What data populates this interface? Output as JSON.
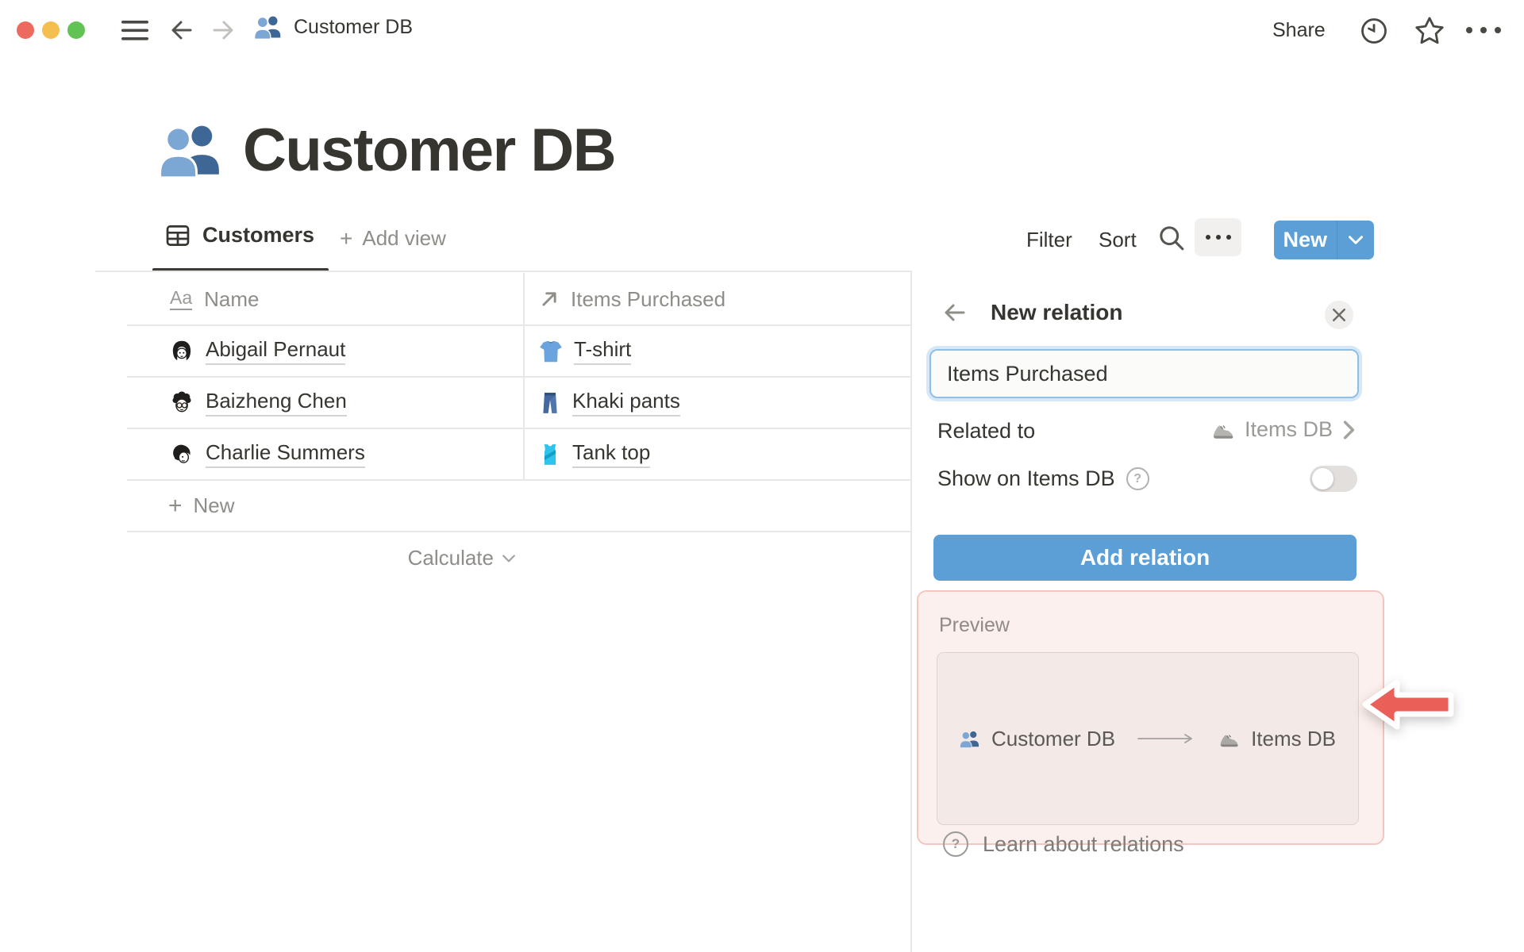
{
  "topbar": {
    "title": "Customer DB",
    "share_label": "Share"
  },
  "page": {
    "title": "Customer DB"
  },
  "toolbar": {
    "tab_label": "Customers",
    "add_plus": "+",
    "add_view_label": "Add view",
    "filter_label": "Filter",
    "sort_label": "Sort",
    "new_label": "New"
  },
  "table": {
    "name_type_icon": "Aa",
    "headers": {
      "name": "Name",
      "items": "Items Purchased"
    },
    "rows": [
      {
        "name": "Abigail Pernaut",
        "item": "T-shirt"
      },
      {
        "name": "Baizheng Chen",
        "item": "Khaki pants"
      },
      {
        "name": "Charlie Summers",
        "item": "Tank top"
      }
    ],
    "new_plus": "+",
    "new_row_label": "New",
    "calculate_label": "Calculate"
  },
  "panel": {
    "title": "New relation",
    "name_input_value": "Items Purchased",
    "related_label": "Related to",
    "related_value": "Items DB",
    "show_label": "Show on Items DB",
    "help_glyph": "?",
    "add_button_label": "Add relation",
    "preview_label": "Preview",
    "preview_source": "Customer DB",
    "preview_target": "Items DB",
    "learn_glyph": "?",
    "learn_label": "Learn about relations"
  },
  "colors": {
    "accent_blue": "#5b9fd6",
    "annotation_red": "#ea5f58",
    "preview_highlight_bg": "#fcf0ee",
    "preview_highlight_border": "#f4c6c2",
    "text_dark": "#37352f",
    "text_gray": "#8f8d88",
    "traffic_red": "#ed6a5e",
    "traffic_yellow": "#f4bf4f",
    "traffic_green": "#61c354"
  }
}
